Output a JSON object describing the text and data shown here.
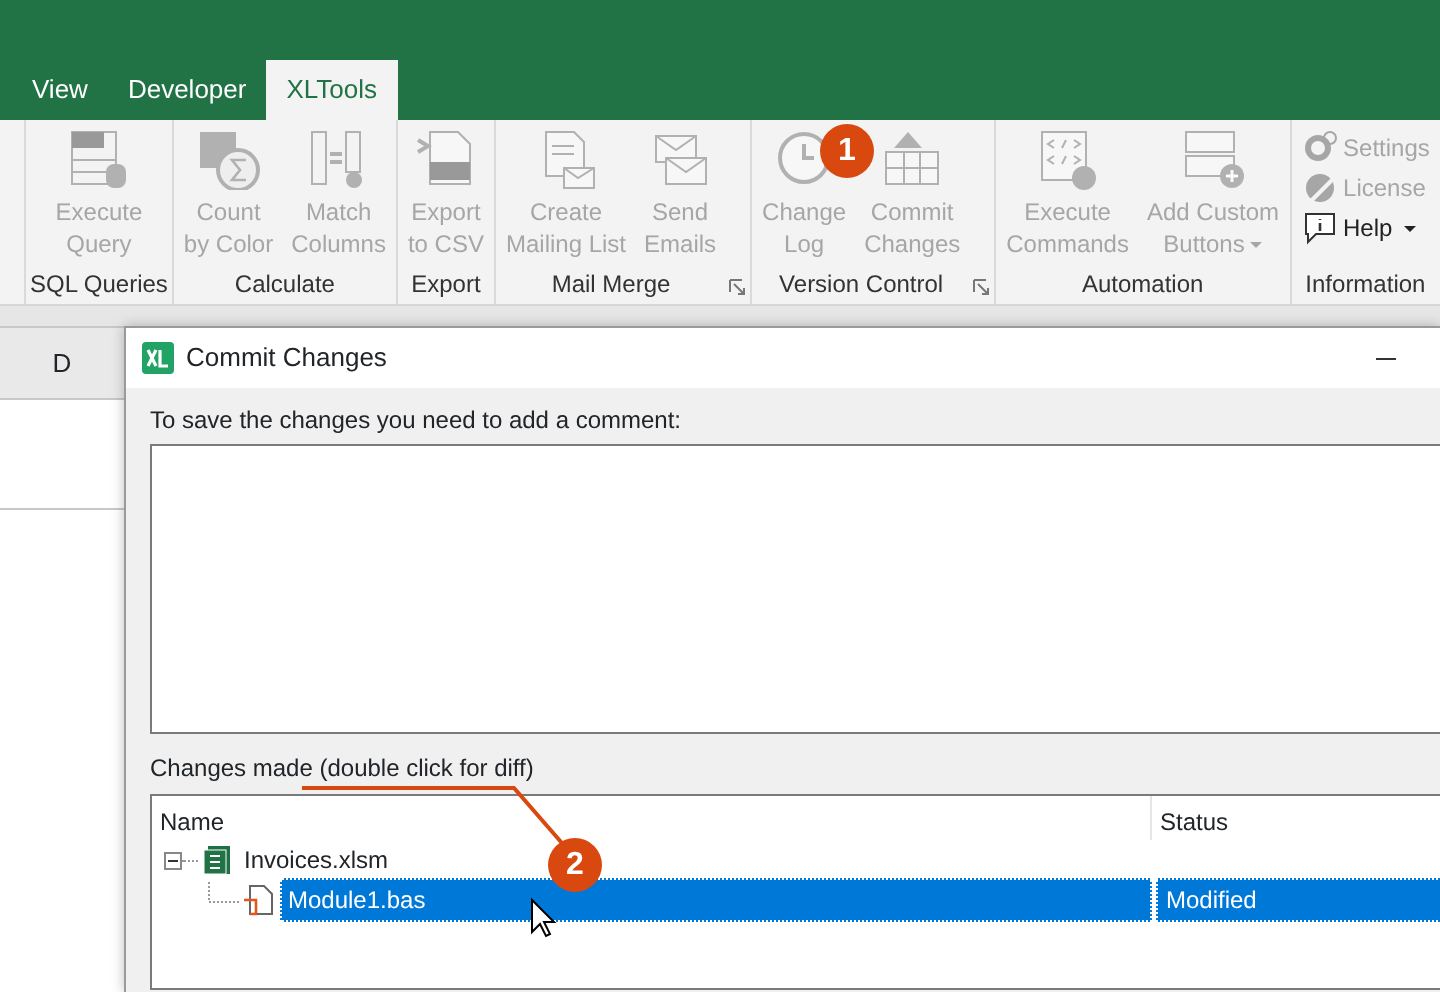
{
  "tabs": [
    {
      "label": "View",
      "selected": false
    },
    {
      "label": "Developer",
      "selected": false
    },
    {
      "label": "XLTools",
      "selected": true
    }
  ],
  "ribbon_groups": [
    {
      "label": "SQL Queries",
      "buttons": [
        {
          "label": [
            "Execute",
            "Query"
          ],
          "disabled": true
        }
      ]
    },
    {
      "label": "Calculate",
      "buttons": [
        {
          "label": [
            "Count",
            "by Color"
          ],
          "disabled": true
        },
        {
          "label": [
            "Match",
            "Columns"
          ],
          "disabled": true
        }
      ]
    },
    {
      "label": "Export",
      "buttons": [
        {
          "label": [
            "Export",
            "to CSV"
          ],
          "disabled": true
        }
      ]
    },
    {
      "label": "Mail Merge",
      "launcher": true,
      "buttons": [
        {
          "label": [
            "Create",
            "Mailing List"
          ],
          "disabled": true
        },
        {
          "label": [
            "Send",
            "Emails"
          ],
          "disabled": true
        }
      ]
    },
    {
      "label": "Version Control",
      "launcher": true,
      "buttons": [
        {
          "label": [
            "Change",
            "Log"
          ],
          "disabled": true
        },
        {
          "label": [
            "Commit",
            "Changes"
          ],
          "disabled": true
        }
      ]
    },
    {
      "label": "Automation",
      "buttons": [
        {
          "label": [
            "Execute",
            "Commands"
          ],
          "disabled": true
        },
        {
          "label": [
            "Add Custom",
            "Buttons"
          ],
          "disabled": true,
          "dropdown": true
        }
      ]
    },
    {
      "label": "Information",
      "small_buttons": [
        {
          "label": "Settings",
          "disabled": true
        },
        {
          "label": "License",
          "disabled": true
        },
        {
          "label": "Help",
          "disabled": false,
          "dropdown": true
        }
      ]
    }
  ],
  "sheet": {
    "column_header": "D"
  },
  "dialog": {
    "title": "Commit Changes",
    "comment_label": "To save the changes you need to add a comment:",
    "changes_label": "Changes made (double click for diff)",
    "tree": {
      "columns": [
        "Name",
        "Status"
      ],
      "items": [
        {
          "name": "Invoices.xlsm",
          "expanded": true,
          "selected": false,
          "children": [
            {
              "name": "Module1.bas",
              "status": "Modified",
              "selected": true
            }
          ]
        }
      ]
    }
  },
  "callouts": [
    {
      "label": "1"
    },
    {
      "label": "2"
    }
  ]
}
